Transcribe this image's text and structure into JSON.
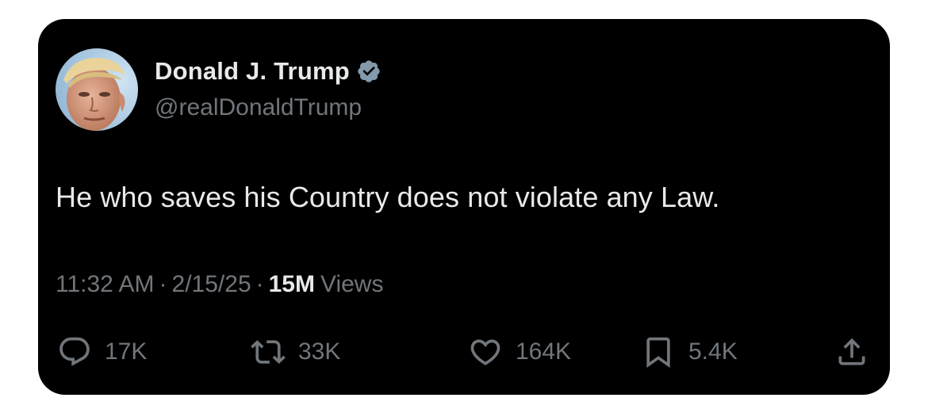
{
  "tweet": {
    "author": {
      "display_name": "Donald J. Trump",
      "handle": "@realDonaldTrump",
      "verified": true,
      "avatar_icon": "profile-photo",
      "verified_icon": "verified-badge-icon"
    },
    "text": "He who saves his Country does not violate any Law.",
    "meta": {
      "time": "11:32 AM",
      "separator": "·",
      "date": "2/15/25",
      "views_count": "15M",
      "views_label": "Views"
    },
    "actions": {
      "reply": {
        "icon": "reply-icon",
        "count": "17K"
      },
      "repost": {
        "icon": "repost-icon",
        "count": "33K"
      },
      "like": {
        "icon": "heart-icon",
        "count": "164K"
      },
      "bookmark": {
        "icon": "bookmark-icon",
        "count": "5.4K"
      },
      "share": {
        "icon": "share-icon"
      }
    }
  },
  "colors": {
    "card_background": "#000000",
    "page_background": "#ffffff",
    "primary_text": "#e7e9ea",
    "secondary_text": "#71767b",
    "verified_badge": "#829aab"
  }
}
